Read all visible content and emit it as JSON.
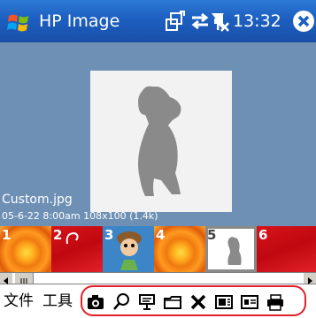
{
  "titlebar": {
    "title": "HP Image",
    "time": "13:32",
    "icons": [
      "windows-start-icon",
      "connectivity-icon",
      "sync-icon",
      "no-signal-icon",
      "volume-icon",
      "close-icon"
    ]
  },
  "preview": {
    "filename": "Custom.jpg",
    "fileinfo": "05-6-22 8:00am 108x100 (1.4k)"
  },
  "thumbnails": [
    {
      "number": "1"
    },
    {
      "number": "2"
    },
    {
      "number": "3"
    },
    {
      "number": "4"
    },
    {
      "number": "5"
    },
    {
      "number": "6"
    }
  ],
  "menubar": {
    "file_label": "文件",
    "tools_label": "工具"
  },
  "toolbar_icons": [
    "camera-icon",
    "search-icon",
    "slideshow-icon",
    "folder-icon",
    "delete-icon",
    "image-info-icon",
    "card-icon",
    "print-icon"
  ],
  "colors": {
    "titlebar": "#1c5fc0",
    "preview_bg": "#6e90b4",
    "highlight_ring": "#e3202a"
  }
}
